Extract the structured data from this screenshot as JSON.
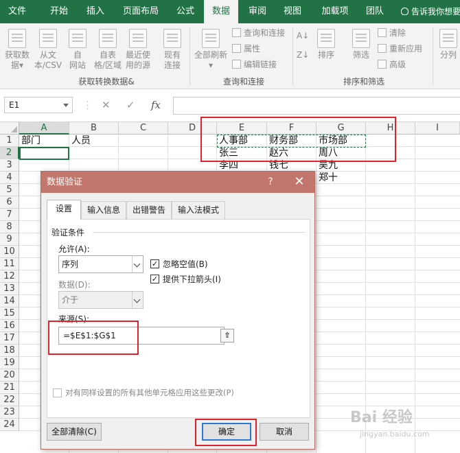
{
  "ribbon": {
    "tabs": [
      "文件",
      "开始",
      "插入",
      "页面布局",
      "公式",
      "数据",
      "审阅",
      "视图",
      "加载项",
      "团队"
    ],
    "active_tab": "数据",
    "tell_me": "告诉我你想要",
    "groups": {
      "get_transform": {
        "label": "获取转换数据&",
        "buttons": [
          {
            "line1": "获取数",
            "line2": "据▾",
            "icon": "database-icon"
          },
          {
            "line1": "从文",
            "line2": "本/CSV",
            "icon": "text-file-icon"
          },
          {
            "line1": "自",
            "line2": "网站",
            "icon": "web-icon"
          },
          {
            "line1": "自表",
            "line2": "格/区域",
            "icon": "table-icon"
          },
          {
            "line1": "最近使",
            "line2": "用的源",
            "icon": "recent-source-icon"
          },
          {
            "line1": "现有",
            "line2": "连接",
            "icon": "connection-icon"
          }
        ]
      },
      "queries": {
        "label": "查询和连接",
        "refresh": {
          "line1": "全部刷新",
          "line2": "▾"
        },
        "items": [
          "查询和连接",
          "属性",
          "编辑链接"
        ]
      },
      "sort_filter": {
        "label": "排序和筛选",
        "sort": "排序",
        "filter": "筛选",
        "items": [
          "清除",
          "重新应用",
          "高级"
        ]
      },
      "tools": {
        "split": "分列"
      }
    }
  },
  "formula_bar": {
    "name_box": "E1",
    "cancel": "✕",
    "enter": "✓",
    "fx": "fx",
    "content": ""
  },
  "sheet": {
    "columns": [
      "A",
      "B",
      "C",
      "D",
      "E",
      "F",
      "G",
      "H",
      "I"
    ],
    "selected_column": "A",
    "rows": [
      "1",
      "2",
      "3",
      "4",
      "5",
      "6",
      "7",
      "8",
      "9",
      "10",
      "11",
      "12",
      "13",
      "14",
      "15",
      "16",
      "17",
      "18",
      "19",
      "20",
      "21",
      "22",
      "23",
      "24"
    ],
    "selected_row": "2",
    "cells": {
      "A1": "部门",
      "B1": "人员",
      "E1": "人事部",
      "F1": "财务部",
      "G1": "市场部",
      "E2": "张三",
      "F2": "赵六",
      "G2": "周八",
      "E3": "李四",
      "F3": "钱七",
      "G3": "吴九",
      "G4": "郑十"
    }
  },
  "dialog": {
    "title": "数据验证",
    "help": "?",
    "close": "✕",
    "tabs": [
      "设置",
      "输入信息",
      "出错警告",
      "输入法模式"
    ],
    "active_tab": "设置",
    "section_label": "验证条件",
    "allow_label": "允许(A):",
    "allow_value": "序列",
    "data_label": "数据(D):",
    "data_value": "介于",
    "ignore_blank": {
      "label": "忽略空值(B)",
      "checked": true
    },
    "in_cell_dropdown": {
      "label": "提供下拉箭头(I)",
      "checked": true
    },
    "source_label": "来源(S):",
    "source_value": "=$E$1:$G$1",
    "apply_all": {
      "label": "对有同样设置的所有其他单元格应用这些更改(P)",
      "checked": false
    },
    "clear_all": "全部清除(C)",
    "ok": "确定",
    "cancel": "取消"
  },
  "watermark": {
    "text": "Bai 经验",
    "sub": "jingyan.baidu.com"
  }
}
